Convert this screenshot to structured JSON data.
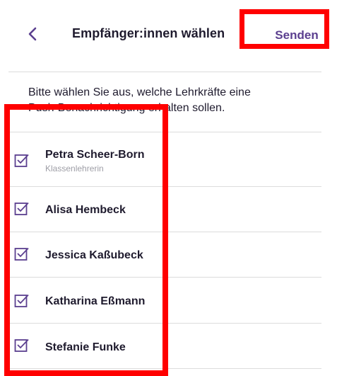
{
  "header": {
    "back_icon": "chevron-left-icon",
    "title": "Empfänger:innen wählen",
    "send_label": "Senden"
  },
  "instructions": {
    "line1": "Bitte wählen Sie aus, welche Lehrkräfte eine",
    "line2": "Push-Benachrichtigung erhalten sollen."
  },
  "recipients": [
    {
      "name": "Petra Scheer-Born",
      "role": "Klassenlehrerin",
      "checked": true
    },
    {
      "name": "Alisa Hembeck",
      "checked": true
    },
    {
      "name": "Jessica Kaßubeck",
      "checked": true
    },
    {
      "name": "Katharina Eßmann",
      "checked": true
    },
    {
      "name": "Stefanie Funke",
      "checked": true
    }
  ],
  "colors": {
    "accent": "#5b3f8f",
    "highlight": "#ff0000",
    "divider": "#dcdcdc"
  }
}
